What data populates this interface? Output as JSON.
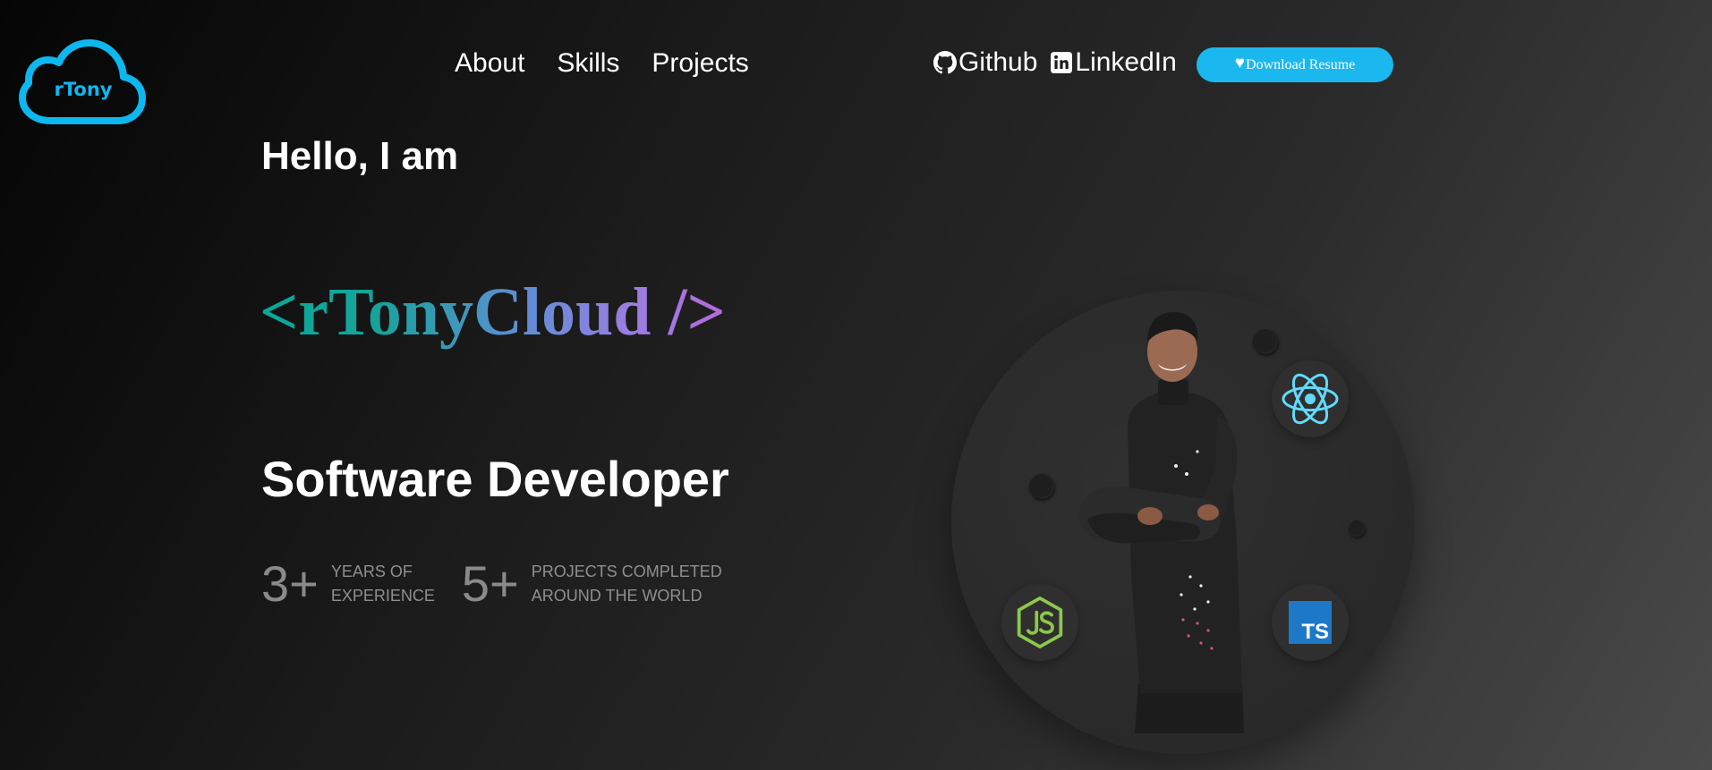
{
  "logo": {
    "text": "rTony"
  },
  "nav": {
    "items": [
      "About",
      "Skills",
      "Projects"
    ]
  },
  "social": {
    "github": "Github",
    "linkedin": "LinkedIn"
  },
  "download": {
    "label": "Download Resume"
  },
  "hero": {
    "greeting": "Hello, I am",
    "brand": "<rTonyCloud />",
    "role": "Software Developer"
  },
  "stats": [
    {
      "number": "3+",
      "line1": "YEARS OF",
      "line2": "EXPERIENCE"
    },
    {
      "number": "5+",
      "line1": "PROJECTS COMPLETED",
      "line2": "AROUND THE WORLD"
    }
  ],
  "tech": {
    "typescript": "TS"
  },
  "icons": {
    "logo": "cloud-icon",
    "github": "github-icon",
    "linkedin": "linkedin-icon",
    "download": "heart-icon",
    "react": "react-icon",
    "node": "nodejs-icon",
    "typescript": "typescript-icon"
  },
  "colors": {
    "accent": "#1ab8ef",
    "brand_gradient": [
      "#0aa898",
      "#5b8fd4",
      "#b46ad8"
    ],
    "stat_text": "#8f8f8f"
  }
}
